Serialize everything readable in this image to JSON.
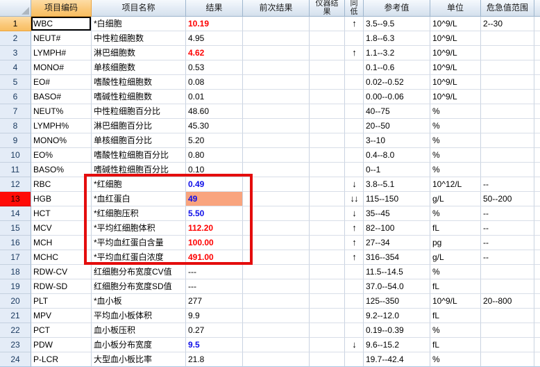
{
  "table": {
    "headers": {
      "code": "项目编码",
      "name": "项目名称",
      "result": "结果",
      "prev_result": "前次结果",
      "instrument_result": "仪器结果",
      "flag": "同低",
      "reference": "参考值",
      "unit": "单位",
      "critical_range": "危急值范围"
    },
    "rows": [
      {
        "num": "1",
        "code": "WBC",
        "name": "*白细胞",
        "result": "10.19",
        "result_style": "high",
        "arrow": "↑",
        "ref": "3.5--9.5",
        "unit": "10^9/L",
        "crit": "2--30",
        "selected": true
      },
      {
        "num": "2",
        "code": "NEUT#",
        "name": "中性粒细胞数",
        "result": "4.95",
        "result_style": "normal",
        "arrow": "",
        "ref": "1.8--6.3",
        "unit": "10^9/L",
        "crit": ""
      },
      {
        "num": "3",
        "code": "LYMPH#",
        "name": "淋巴细胞数",
        "result": "4.62",
        "result_style": "high",
        "arrow": "↑",
        "ref": "1.1--3.2",
        "unit": "10^9/L",
        "crit": ""
      },
      {
        "num": "4",
        "code": "MONO#",
        "name": "单核细胞数",
        "result": "0.53",
        "result_style": "normal",
        "arrow": "",
        "ref": "0.1--0.6",
        "unit": "10^9/L",
        "crit": ""
      },
      {
        "num": "5",
        "code": "EO#",
        "name": "嗜酸性粒细胞数",
        "result": "0.08",
        "result_style": "normal",
        "arrow": "",
        "ref": "0.02--0.52",
        "unit": "10^9/L",
        "crit": ""
      },
      {
        "num": "6",
        "code": "BASO#",
        "name": "嗜碱性粒细胞数",
        "result": "0.01",
        "result_style": "normal",
        "arrow": "",
        "ref": "0.00--0.06",
        "unit": "10^9/L",
        "crit": ""
      },
      {
        "num": "7",
        "code": "NEUT%",
        "name": "中性粒细胞百分比",
        "result": "48.60",
        "result_style": "normal",
        "arrow": "",
        "ref": "40--75",
        "unit": "%",
        "crit": ""
      },
      {
        "num": "8",
        "code": "LYMPH%",
        "name": "淋巴细胞百分比",
        "result": "45.30",
        "result_style": "normal",
        "arrow": "",
        "ref": "20--50",
        "unit": "%",
        "crit": ""
      },
      {
        "num": "9",
        "code": "MONO%",
        "name": "单核细胞百分比",
        "result": "5.20",
        "result_style": "normal",
        "arrow": "",
        "ref": "3--10",
        "unit": "%",
        "crit": ""
      },
      {
        "num": "10",
        "code": "EO%",
        "name": "嗜酸性粒细胞百分比",
        "result": "0.80",
        "result_style": "normal",
        "arrow": "",
        "ref": "0.4--8.0",
        "unit": "%",
        "crit": ""
      },
      {
        "num": "11",
        "code": "BASO%",
        "name": "嗜碱性粒细胞百分比",
        "result": "0.10",
        "result_style": "normal",
        "arrow": "",
        "ref": "0--1",
        "unit": "%",
        "crit": ""
      },
      {
        "num": "12",
        "code": "RBC",
        "name": "*红细胞",
        "result": "0.49",
        "result_style": "low",
        "arrow": "↓",
        "ref": "3.8--5.1",
        "unit": "10^12/L",
        "crit": "--"
      },
      {
        "num": "13",
        "code": "HGB",
        "name": "*血红蛋白",
        "result": "49",
        "result_style": "low",
        "result_highlight": true,
        "row_header": "red",
        "arrow": "↓↓",
        "ref": "115--150",
        "unit": "g/L",
        "crit": "50--200"
      },
      {
        "num": "14",
        "code": "HCT",
        "name": "*红细胞压积",
        "result": "5.50",
        "result_style": "low",
        "arrow": "↓",
        "ref": "35--45",
        "unit": "%",
        "crit": "--"
      },
      {
        "num": "15",
        "code": "MCV",
        "name": "*平均红细胞体积",
        "result": "112.20",
        "result_style": "high",
        "arrow": "↑",
        "ref": "82--100",
        "unit": "fL",
        "crit": "--"
      },
      {
        "num": "16",
        "code": "MCH",
        "name": "*平均血红蛋白含量",
        "result": "100.00",
        "result_style": "high",
        "arrow": "↑",
        "ref": "27--34",
        "unit": "pg",
        "crit": "--"
      },
      {
        "num": "17",
        "code": "MCHC",
        "name": "*平均血红蛋白浓度",
        "result": "491.00",
        "result_style": "high",
        "arrow": "↑",
        "ref": "316--354",
        "unit": "g/L",
        "crit": "--"
      },
      {
        "num": "18",
        "code": "RDW-CV",
        "name": "红细胞分布宽度CV值",
        "result": "---",
        "result_style": "normal",
        "arrow": "",
        "ref": "11.5--14.5",
        "unit": "%",
        "crit": ""
      },
      {
        "num": "19",
        "code": "RDW-SD",
        "name": "红细胞分布宽度SD值",
        "result": "---",
        "result_style": "normal",
        "arrow": "",
        "ref": "37.0--54.0",
        "unit": "fL",
        "crit": ""
      },
      {
        "num": "20",
        "code": "PLT",
        "name": "*血小板",
        "result": "277",
        "result_style": "normal",
        "arrow": "",
        "ref": "125--350",
        "unit": "10^9/L",
        "crit": "20--800"
      },
      {
        "num": "21",
        "code": "MPV",
        "name": "平均血小板体积",
        "result": "9.9",
        "result_style": "normal",
        "arrow": "",
        "ref": "9.2--12.0",
        "unit": "fL",
        "crit": ""
      },
      {
        "num": "22",
        "code": "PCT",
        "name": "血小板压积",
        "result": "0.27",
        "result_style": "normal",
        "arrow": "",
        "ref": "0.19--0.39",
        "unit": "%",
        "crit": ""
      },
      {
        "num": "23",
        "code": "PDW",
        "name": "血小板分布宽度",
        "result": "9.5",
        "result_style": "low",
        "arrow": "↓",
        "ref": "9.6--15.2",
        "unit": "fL",
        "crit": ""
      },
      {
        "num": "24",
        "code": "P-LCR",
        "name": "大型血小板比率",
        "result": "21.8",
        "result_style": "normal",
        "arrow": "",
        "ref": "19.7--42.4",
        "unit": "%",
        "crit": ""
      }
    ]
  },
  "colors": {
    "abnormal_high_text": "#FE0000",
    "abnormal_low_text": "#0D0DE8",
    "result_highlight_bg": "#F9A47E",
    "row_header_alert_bg": "#FF0B07",
    "selected_header_bg": "#FAC878",
    "header_bg": "#E3EBF5",
    "annotation_box": "#E40D0D"
  }
}
